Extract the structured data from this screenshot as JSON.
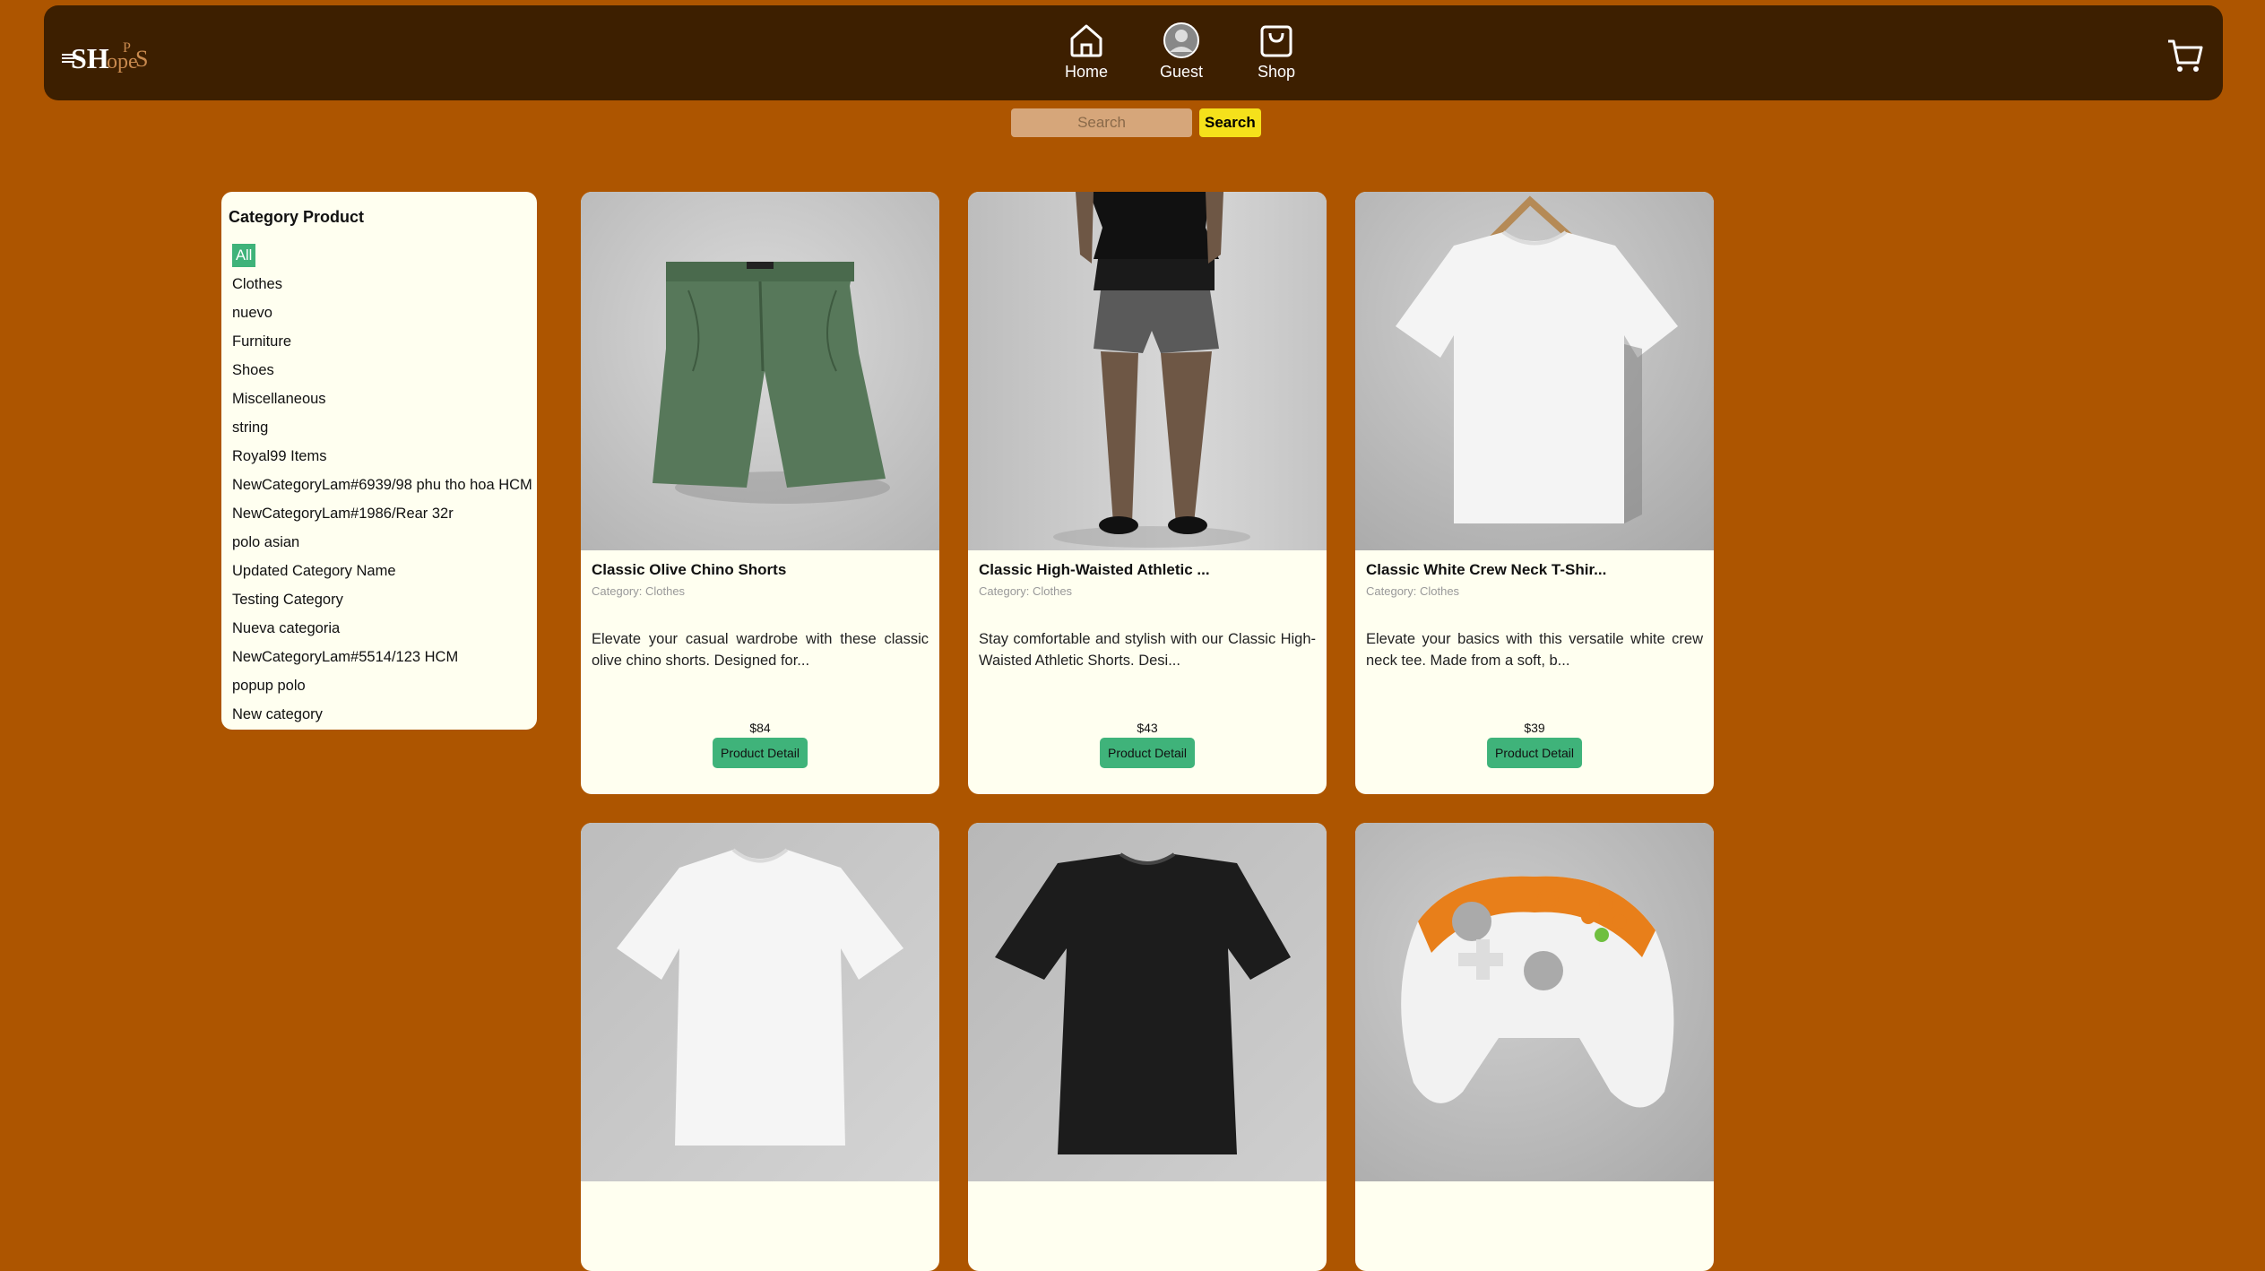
{
  "header": {
    "logo_text": "ShopPS",
    "nav": [
      {
        "label": "Home",
        "icon": "home-icon"
      },
      {
        "label": "Guest",
        "icon": "user-avatar-icon"
      },
      {
        "label": "Shop",
        "icon": "shopping-bag-icon"
      }
    ],
    "cart_icon": "cart-icon"
  },
  "search": {
    "placeholder": "Search",
    "button_label": "Search"
  },
  "sidebar": {
    "title": "Category Product",
    "categories": [
      "All",
      "Clothes",
      "nuevo",
      "Furniture",
      "Shoes",
      "Miscellaneous",
      "string",
      "Royal99 Items",
      "NewCategoryLam#6939/98 phu tho hoa HCM",
      "NewCategoryLam#1986/Rear 32r",
      "polo asian",
      "Updated Category Name",
      "Testing Category",
      "Nueva categoria",
      "NewCategoryLam#5514/123 HCM",
      "popup polo",
      "New category"
    ],
    "active": "All"
  },
  "products": [
    {
      "title": "Classic Olive Chino Shorts",
      "category": "Category: Clothes",
      "description": "Elevate your casual wardrobe with these classic olive chino shorts. Designed for...",
      "price": "$84",
      "button": "Product Detail"
    },
    {
      "title": "Classic High-Waisted Athletic ...",
      "category": "Category: Clothes",
      "description": "Stay comfortable and stylish with our Classic High-Waisted Athletic Shorts. Desi...",
      "price": "$43",
      "button": "Product Detail"
    },
    {
      "title": "Classic White Crew Neck T-Shir...",
      "category": "Category: Clothes",
      "description": "Elevate your basics with this versatile white crew neck tee. Made from a soft, b...",
      "price": "$39",
      "button": "Product Detail"
    }
  ],
  "colors": {
    "background": "#ad5500",
    "navbar": "#3d1f00",
    "card": "#fffff0",
    "accent_green": "#3fb37a",
    "search_button": "#f5e11b"
  }
}
